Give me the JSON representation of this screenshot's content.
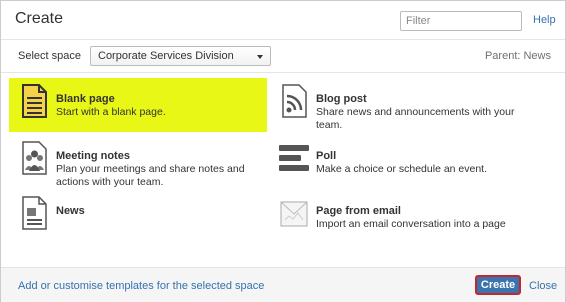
{
  "dialog": {
    "title": "Create",
    "filter_placeholder": "Filter",
    "help_label": "Help"
  },
  "space": {
    "label": "Select space",
    "selected": "Corporate Services Division",
    "parent": "Parent: News"
  },
  "templates": [
    {
      "name": "Blank page",
      "desc": "Start with a blank page.",
      "icon": "blank-page-icon",
      "selected": true
    },
    {
      "name": "Blog post",
      "desc": "Share news and announcements with your team.",
      "icon": "rss-feed-icon"
    },
    {
      "name": "Meeting notes",
      "desc": "Plan your meetings and share notes and actions with your team.",
      "icon": "meeting-notes-icon"
    },
    {
      "name": "Poll",
      "desc": "Make a choice or schedule an event.",
      "icon": "poll-bars-icon"
    },
    {
      "name": "News",
      "desc": "",
      "icon": "news-page-icon"
    },
    {
      "name": "Page from email",
      "desc": "Import an email conversation into a page",
      "icon": "email-page-icon"
    }
  ],
  "footer": {
    "link": "Add or customise templates for the selected space",
    "create_label": "Create",
    "close_label": "Close"
  },
  "colors": {
    "selected_highlight": "#e9f716",
    "link": "#3572b0",
    "primary_button": "#3b73af",
    "button_outline": "#c1272d"
  }
}
